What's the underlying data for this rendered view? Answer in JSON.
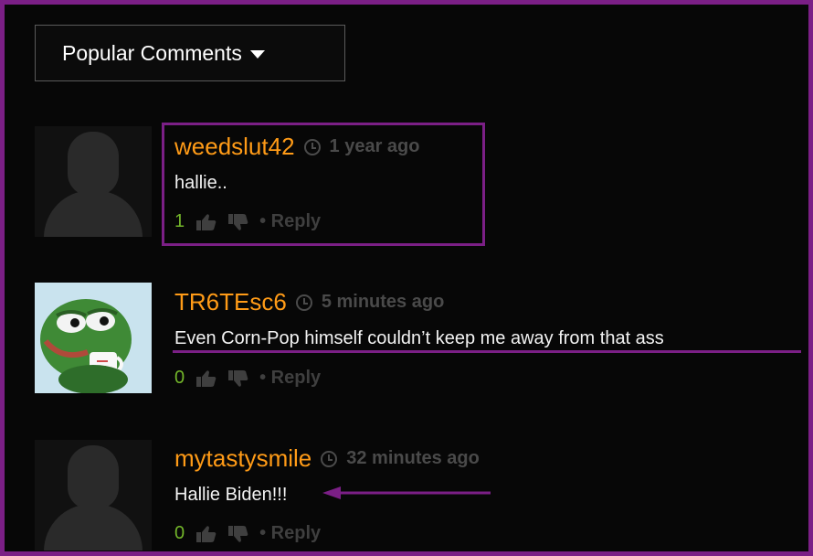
{
  "sort_menu": {
    "label": "Popular Comments"
  },
  "colors": {
    "highlight": "#7b1f86",
    "username": "#ff9b17",
    "vote_count": "#73b62a",
    "meta": "#4a4a4a"
  },
  "comments": [
    {
      "username": "weedslut42",
      "time": "1 year ago",
      "text": "hallie..",
      "votes": "1",
      "reply_label": "• Reply",
      "avatar": "default-avatar"
    },
    {
      "username": "TR6TEsc6",
      "time": "5 minutes ago",
      "text": "Even Corn-Pop himself couldn’t keep me away from that ass",
      "votes": "0",
      "reply_label": "• Reply",
      "avatar": "pepe-frog-avatar"
    },
    {
      "username": "mytastysmile",
      "time": "32 minutes ago",
      "text": "Hallie Biden!!!",
      "votes": "0",
      "reply_label": "• Reply",
      "avatar": "default-avatar"
    }
  ]
}
